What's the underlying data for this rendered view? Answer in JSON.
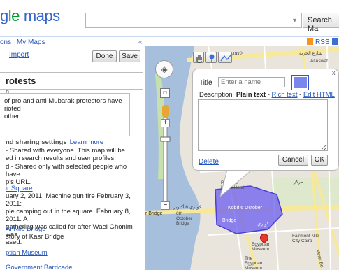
{
  "header": {
    "logo_g": "g",
    "logo_l": "le",
    "logo_maps": "maps",
    "search_value": "",
    "search_button": "Search Ma"
  },
  "panel": {
    "tabs": [
      "ons",
      "My Maps"
    ],
    "collapse": "«",
    "import_link": "Import",
    "done_button": "Done",
    "save_button": "Save",
    "title_value": "rotests",
    "description_label": "n",
    "description_line1_pre": "of pro and anti Mubarak ",
    "description_underlined": "protestors",
    "description_line1_post": " have rioted",
    "description_line2": "other.",
    "sharing_title": "nd sharing settings",
    "learn_more": "Learn more",
    "public_line1": "- Shared with everyone. This map will be",
    "public_line2": "ed in search results and user profiles.",
    "unlisted_line1": "d - Shared only with selected people who have",
    "unlisted_line2": "p's URL.",
    "places": [
      {
        "name": "ir Square",
        "lines": [
          "uary 2, 2011: Machine gun fire February 3, 2011:",
          "ple camping out in the square. February 8, 2011: A",
          "gathering was called for after Wael Ghonim was",
          "ased."
        ]
      },
      {
        "name": "Al Nile Bridge",
        "lines": [
          "story of Kasr Bridge"
        ]
      },
      {
        "name": "ptian Museum",
        "lines": []
      },
      {
        "name": "Government Barricade",
        "lines": []
      }
    ]
  },
  "map": {
    "rss_label": "RSS",
    "street_labels": {
      "may15": "15 Mayo",
      "arabic_road": "شارع الحرية",
      "alaswat": "Al Aswat",
      "ramses": "Ramses Hilton Hotel",
      "kobri": "Kobri 6 October",
      "bridge": "Bridge",
      "rbridge": "r Bridge",
      "oct6": "6th October Bridge",
      "museum": "Egyptian Museum",
      "museum_egypt": "The Egyptian Museum",
      "fairmont": "Fairmont Nile City Cairo",
      "meret": "Meret Ba",
      "arabic_kobri": "كوبري",
      "arabic_ctr": "مركز",
      "arabic_left": "كوبري 6 أكتوبر"
    },
    "colors": {
      "water": "#a5bfdd",
      "land": "#e9e5dc",
      "road_major": "#f7e89a",
      "road_minor": "#ffffff",
      "polygon": "#6a5cf0",
      "park": "#c8dfae",
      "marker": "#e23a2b"
    }
  },
  "popup": {
    "title_label": "Title",
    "title_placeholder": "Enter a name",
    "description_label": "Description",
    "plain_text": "Plain text",
    "sep1": " - ",
    "rich_text": "Rich text",
    "sep2": " - ",
    "edit_html": "Edit HTML",
    "delete_link": "Delete",
    "cancel_button": "Cancel",
    "ok_button": "OK",
    "close_label": "x",
    "color_swatch": "#7a86ee"
  },
  "icons": [
    "hand-icon",
    "marker-icon",
    "line-icon",
    "pan-icon",
    "zoom-in-icon",
    "zoom-out-icon",
    "pegman-icon",
    "rss-icon",
    "close-icon"
  ]
}
